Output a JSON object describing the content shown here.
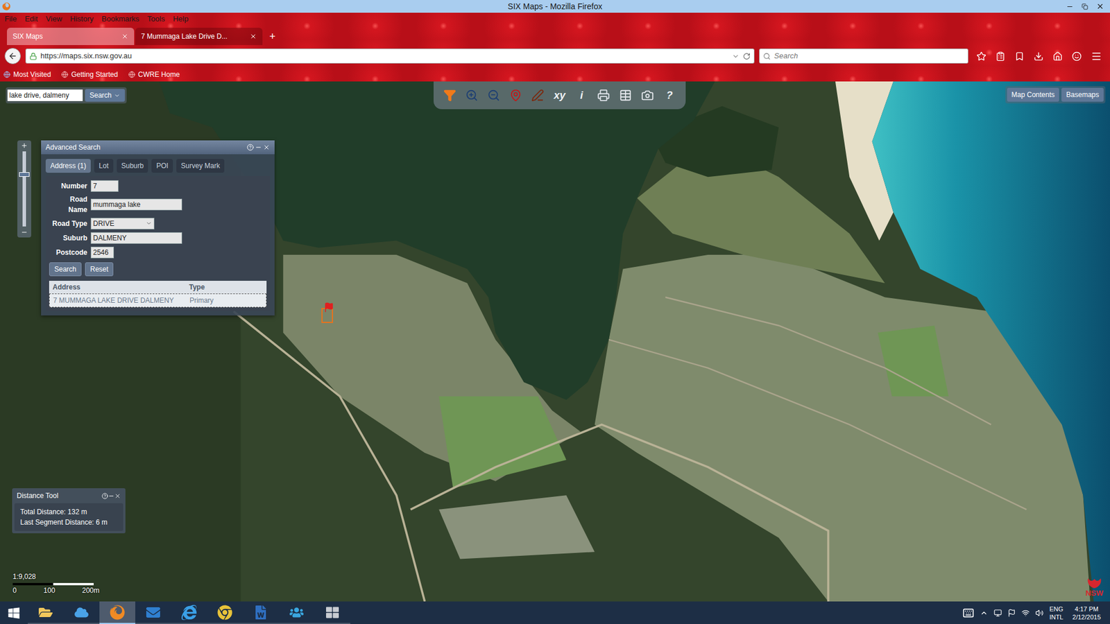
{
  "window": {
    "title": "SIX Maps - Mozilla Firefox"
  },
  "menu": [
    "File",
    "Edit",
    "View",
    "History",
    "Bookmarks",
    "Tools",
    "Help"
  ],
  "tabs": [
    {
      "label": "SIX Maps",
      "selected": true
    },
    {
      "label": "7 Mummaga Lake Drive D...",
      "selected": false
    }
  ],
  "new_tab": "+",
  "url": "https://maps.six.nsw.gov.au",
  "search": {
    "placeholder": "Search"
  },
  "bookmarks": [
    "Most Visited",
    "Getting Started",
    "CWRE Home"
  ],
  "map": {
    "quick_search": {
      "value": "lake drive, dalmeny",
      "button": "Search"
    },
    "toolbar": [
      {
        "kind": "icon"
      },
      {
        "kind": "icon"
      },
      {
        "kind": "icon"
      },
      {
        "kind": "icon"
      },
      {
        "kind": "icon"
      },
      {
        "kind": "text",
        "label": "xy"
      },
      {
        "kind": "text",
        "label": "i"
      },
      {
        "kind": "icon"
      },
      {
        "kind": "icon"
      },
      {
        "kind": "icon"
      },
      {
        "kind": "text",
        "label": "?"
      }
    ],
    "buttons": [
      "Map Contents",
      "Basemaps"
    ],
    "zoom": {
      "level": 0.72
    },
    "advanced_search": {
      "title": "Advanced Search",
      "tabs": [
        {
          "label": "Address (1)",
          "selected": true
        },
        {
          "label": "Lot",
          "selected": false
        },
        {
          "label": "Suburb",
          "selected": false
        },
        {
          "label": "POI",
          "selected": false
        },
        {
          "label": "Survey Mark",
          "selected": false
        }
      ],
      "fields": [
        {
          "label": "Number",
          "value": "7",
          "kind": "input"
        },
        {
          "label": "Road Name",
          "value": "mummaga lake",
          "kind": "input"
        },
        {
          "label": "Road Type",
          "value": "DRIVE",
          "kind": "select"
        },
        {
          "label": "Suburb",
          "value": "DALMENY",
          "kind": "input"
        },
        {
          "label": "Postcode",
          "value": "2546",
          "kind": "input"
        }
      ],
      "buttons": [
        "Search",
        "Reset"
      ],
      "table": {
        "columns": [
          "Address",
          "Type"
        ],
        "rows": [
          {
            "address": "7 MUMMAGA LAKE DRIVE DALMENY",
            "type": "Primary",
            "selected": true
          }
        ]
      }
    },
    "distance_tool": {
      "title": "Distance Tool",
      "lines": [
        "Total Distance: 132 m",
        "Last Segment Distance: 6 m"
      ]
    },
    "scale": {
      "ratio": "1:9,028",
      "ticks": [
        "0",
        "100",
        "200m"
      ]
    },
    "logo": "NSW"
  },
  "taskbar": {
    "apps": [
      {
        "selected": false
      },
      {
        "selected": false
      },
      {
        "selected": true
      },
      {
        "selected": false
      },
      {
        "selected": false
      },
      {
        "selected": false
      },
      {
        "selected": false
      },
      {
        "selected": false
      },
      {
        "selected": false
      }
    ],
    "language": [
      "ENG",
      "INTL"
    ],
    "time": "4:17 PM",
    "date": "2/12/2015"
  }
}
